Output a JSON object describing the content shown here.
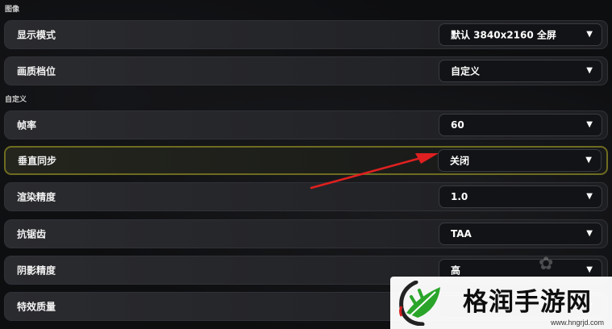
{
  "sections": {
    "graphics": "图像",
    "custom": "自定义"
  },
  "settings": [
    {
      "label": "显示模式",
      "value": "默认 3840x2160 全屏"
    },
    {
      "label": "画质档位",
      "value": "自定义"
    },
    {
      "label": "帧率",
      "value": "60"
    },
    {
      "label": "垂直同步",
      "value": "关闭",
      "highlighted": true
    },
    {
      "label": "渲染精度",
      "value": "1.0"
    },
    {
      "label": "抗锯齿",
      "value": "TAA"
    },
    {
      "label": "阴影精度",
      "value": "高"
    },
    {
      "label": "特效质量",
      "value": ""
    }
  ],
  "caret_glyph": "▼",
  "watermark": {
    "title": "格润手游网",
    "url": "www.hngrjd.com"
  },
  "colors": {
    "highlight_border": "#6d6c20",
    "arrow": "#e02020",
    "logo_green": "#2aa52a"
  },
  "icons": {
    "dropdown": "chevron-down-icon",
    "logo": "leaf-logo-icon"
  }
}
